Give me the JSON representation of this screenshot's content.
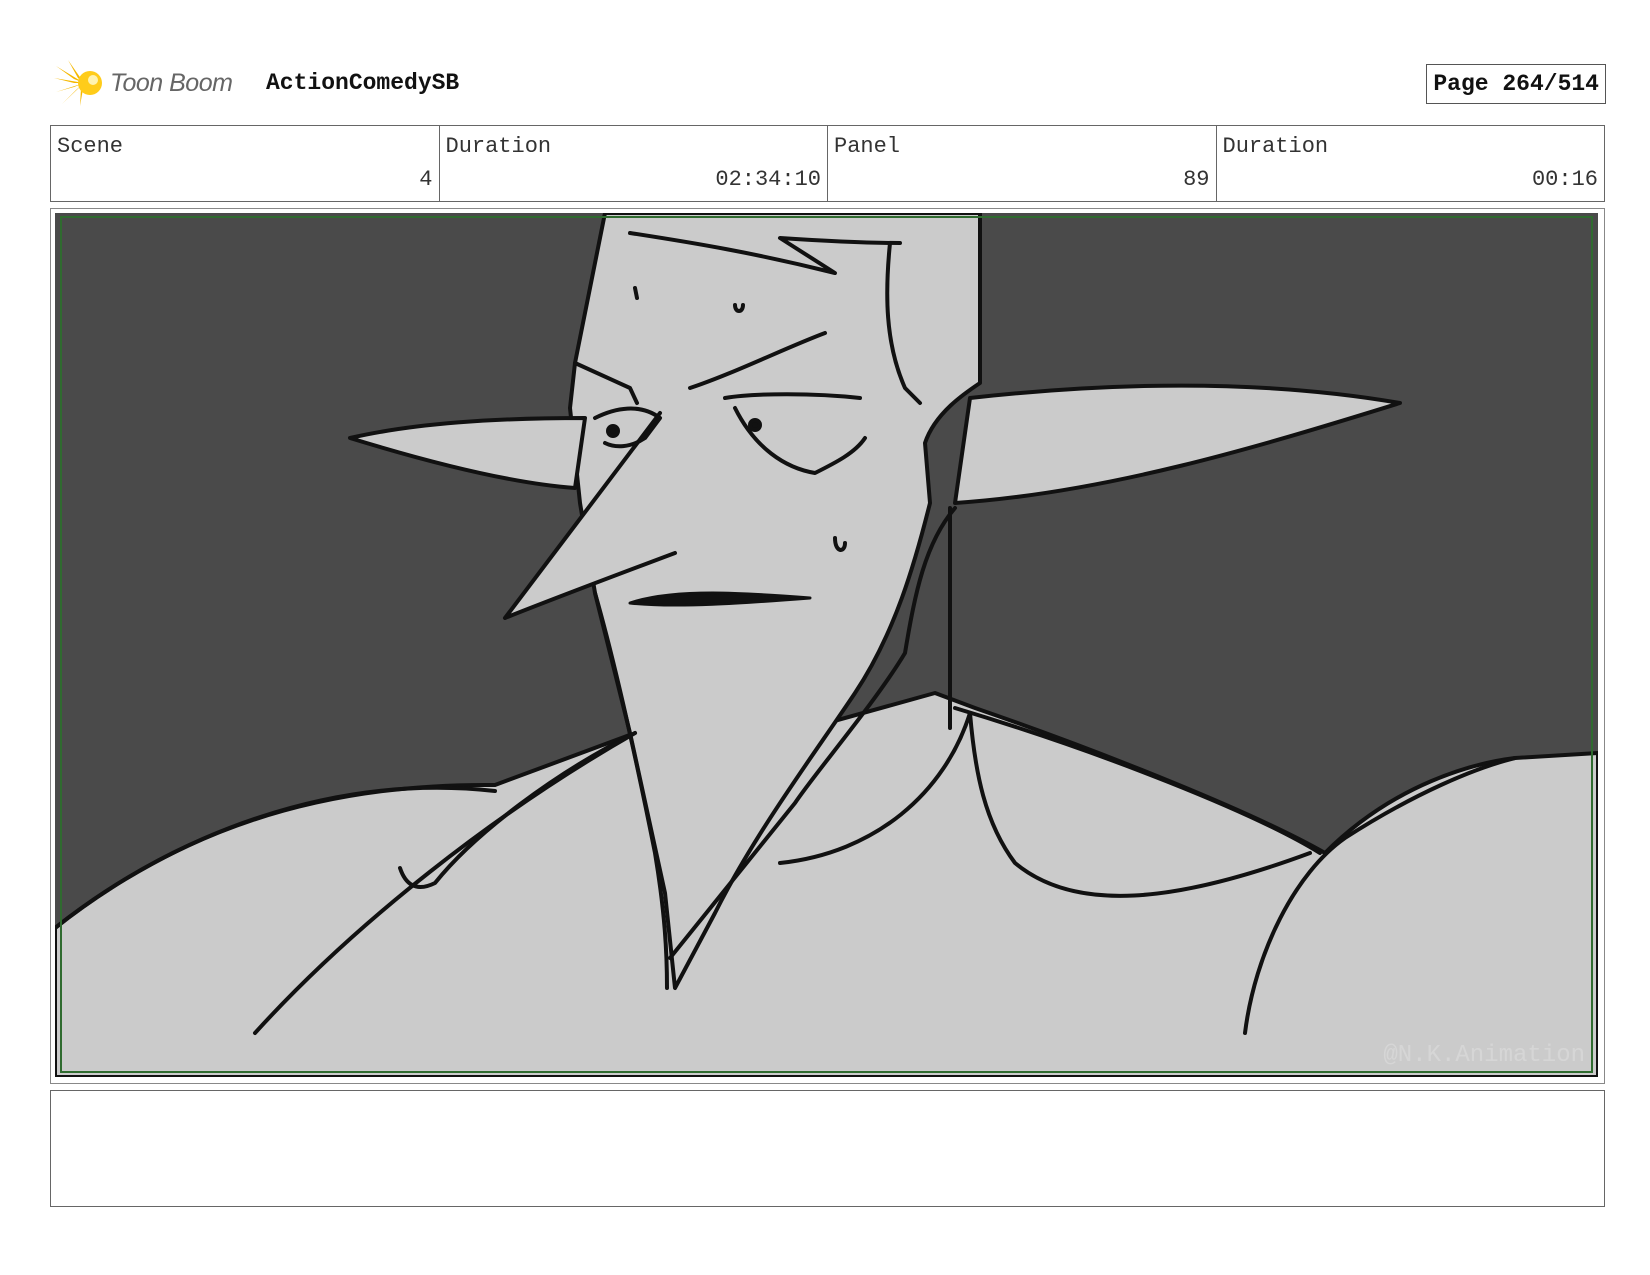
{
  "header": {
    "logo_text": "Toon Boom",
    "project_title": "ActionComedySB",
    "page_label": "Page 264/514"
  },
  "info": {
    "scene_label": "Scene",
    "scene_value": "4",
    "scene_duration_label": "Duration",
    "scene_duration_value": "02:34:10",
    "panel_label": "Panel",
    "panel_value": "89",
    "panel_duration_label": "Duration",
    "panel_duration_value": "00:16"
  },
  "panel": {
    "watermark": "@N.K.Animation",
    "colors": {
      "background": "#4a4a4a",
      "character_fill": "#cbcbcb",
      "line": "#111111",
      "safe_frame": "#2f6b2f"
    }
  },
  "notes": {
    "text": ""
  }
}
